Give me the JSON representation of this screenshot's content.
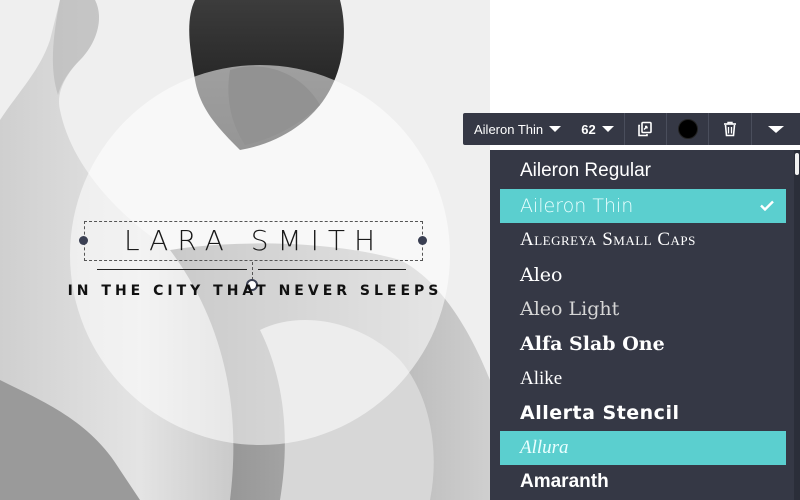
{
  "canvas": {
    "title": "LARA SMITH",
    "subtitle": "IN THE CITY THAT NEVER SLEEPS"
  },
  "toolbar": {
    "font_name": "Aileron Thin",
    "font_size": "62",
    "text_color": "#000000",
    "icons": [
      "duplicate-icon",
      "trash-icon",
      "chevron-down-icon"
    ]
  },
  "font_dropdown": {
    "selected": "Aileron Thin",
    "items": [
      {
        "label": "Aileron Regular"
      },
      {
        "label": "Aileron Thin"
      },
      {
        "label": "Alegreya Small Caps"
      },
      {
        "label": "Aleo"
      },
      {
        "label": "Aleo Light"
      },
      {
        "label": "Alfa Slab One"
      },
      {
        "label": "Alike"
      },
      {
        "label": "Allerta Stencil"
      },
      {
        "label": "Allura"
      },
      {
        "label": "Amaranth"
      }
    ]
  },
  "colors": {
    "toolbar_bg": "#353845",
    "highlight": "#5bcfcf",
    "text": "#ffffff"
  }
}
